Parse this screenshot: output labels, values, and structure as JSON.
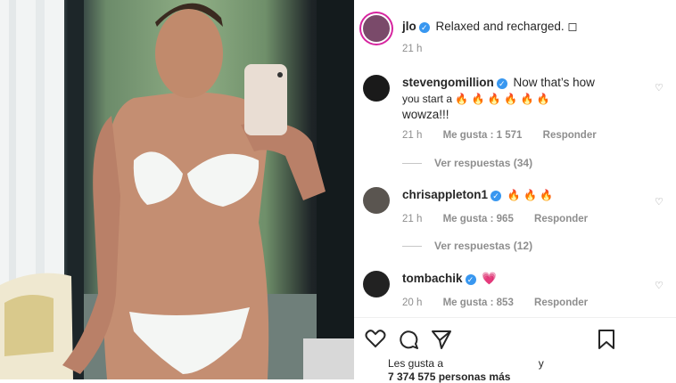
{
  "post": {
    "author": "jlo",
    "caption": "Relaxed and recharged. ◻",
    "time": "21 h"
  },
  "comments": [
    {
      "user": "stevengomillion",
      "text_line1": "Now that’s how",
      "text_line2": "you start a 🔥 🔥 🔥 🔥 🔥 🔥",
      "text_line3": "wowza!!!",
      "time": "21 h",
      "likes": "Me gusta : 1 571",
      "reply": "Responder",
      "view_replies": "Ver respuestas (34)"
    },
    {
      "user": "chrisappleton1",
      "text_line1": "🔥 🔥 🔥",
      "time": "21 h",
      "likes": "Me gusta : 965",
      "reply": "Responder",
      "view_replies": "Ver respuestas (12)"
    },
    {
      "user": "tombachik",
      "text_line1": "💗",
      "time": "20 h",
      "likes": "Me gusta : 853",
      "reply": "Responder"
    }
  ],
  "likes_bar": {
    "prefix": "Les gusta a",
    "suffix": "y",
    "count": "7 374 575 personas más"
  },
  "colors": {
    "accent": "#3897f0",
    "muted": "#8e8e8e",
    "story_ring": "#d6249f"
  },
  "icons": [
    "heart-icon",
    "comment-icon",
    "share-icon",
    "bookmark-icon",
    "verified-icon"
  ]
}
